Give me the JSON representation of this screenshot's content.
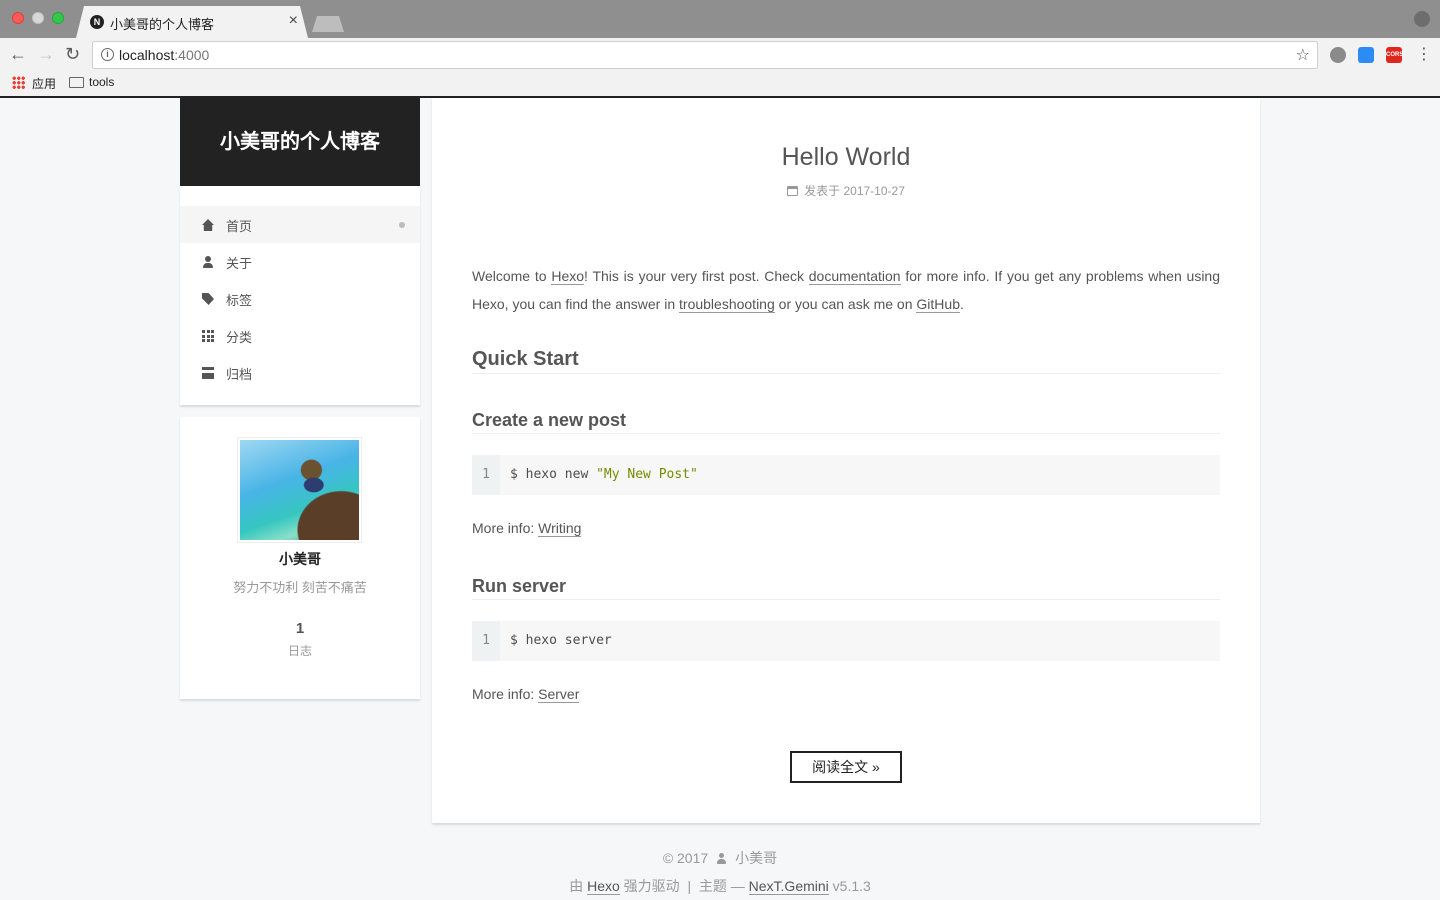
{
  "browser": {
    "tab_title": "小美哥的个人博客",
    "tab_favicon": "N",
    "url_host": "localhost",
    "url_port": ":4000",
    "bookmarks": [
      {
        "label": "应用",
        "icon": "apps-grid-icon"
      },
      {
        "label": "tools",
        "icon": "folder-icon"
      }
    ],
    "extension_labels": {
      "cors": "CORS"
    }
  },
  "site": {
    "title": "小美哥的个人博客"
  },
  "menu": {
    "items": [
      {
        "label": "首页",
        "icon": "home-icon",
        "active": true
      },
      {
        "label": "关于",
        "icon": "user-icon"
      },
      {
        "label": "标签",
        "icon": "tags-icon"
      },
      {
        "label": "分类",
        "icon": "th-icon"
      },
      {
        "label": "归档",
        "icon": "archive-icon"
      }
    ]
  },
  "author": {
    "name": "小美哥",
    "motto": "努力不功利 刻苦不痛苦",
    "post_count": "1",
    "post_count_label": "日志"
  },
  "post": {
    "title": "Hello World",
    "meta_prefix": "发表于",
    "date": "2017-10-27",
    "intro": {
      "t1": "Welcome to ",
      "l1": "Hexo",
      "t2": "! This is your very first post. Check ",
      "l2": "documentation",
      "t3": " for more info. If you get any problems when using Hexo, you can find the answer in ",
      "l3": "troubleshooting",
      "t4": " or you can ask me on ",
      "l4": "GitHub",
      "t5": "."
    },
    "h_quick_start": "Quick Start",
    "h_create": "Create a new post",
    "code1": {
      "line_no": "1",
      "cmd": "$ hexo new ",
      "str": "\"My New Post\""
    },
    "more1_prefix": "More info: ",
    "more1_link": "Writing",
    "h_run": "Run server",
    "code2": {
      "line_no": "1",
      "cmd": "$ hexo server"
    },
    "more2_prefix": "More info: ",
    "more2_link": "Server",
    "read_more": "阅读全文 »"
  },
  "footer": {
    "copyright": "© 2017",
    "author": "小美哥",
    "powered_prefix": "由",
    "powered_link": "Hexo",
    "powered_suffix": "强力驱动",
    "separator": "|",
    "theme_prefix": "主题 —",
    "theme_link": "NexT.Gemini",
    "theme_version": "v5.1.3"
  }
}
